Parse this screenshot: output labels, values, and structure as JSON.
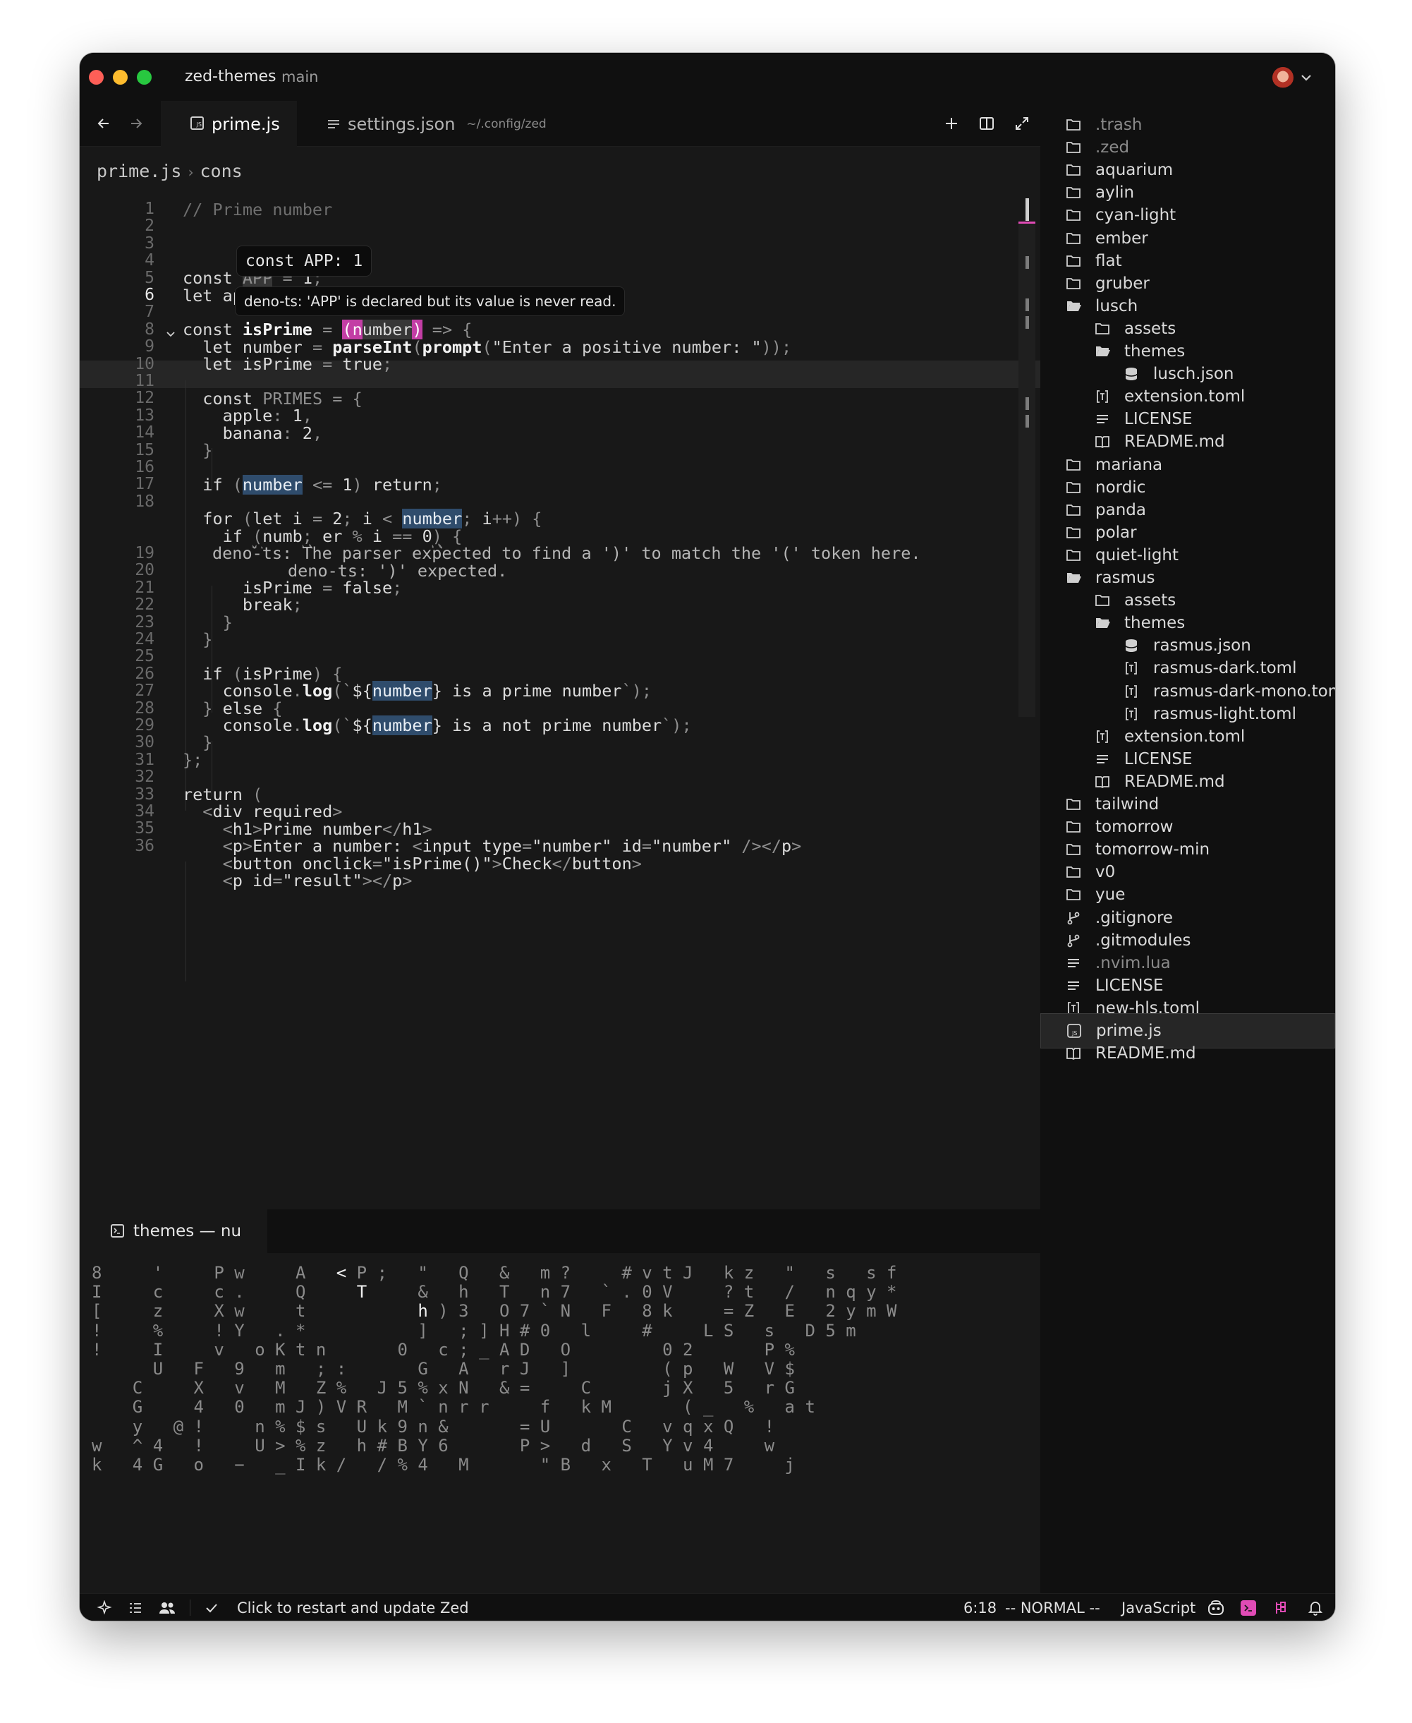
{
  "window": {
    "project": "zed-themes",
    "branch": "main"
  },
  "tabs": [
    {
      "label": "prime.js",
      "active": true
    },
    {
      "label": "settings.json",
      "path": "~/.config/zed",
      "active": false
    }
  ],
  "breadcrumb": {
    "file": "prime.js",
    "symbol": "cons"
  },
  "hover_tooltip": "const APP: 1",
  "diagnostic_tooltip": "deno-ts: 'APP' is declared but its value is never read.",
  "code": {
    "line_numbers": [
      "1",
      "2",
      "3",
      "4",
      "5",
      "6",
      "7",
      "8",
      "9",
      "10",
      "11",
      "12",
      "13",
      "14",
      "15",
      "16",
      "17",
      "18",
      "",
      "",
      "19",
      "20",
      "21",
      "22",
      "23",
      "24",
      "25",
      "26",
      "27",
      "28",
      "29",
      "30",
      "31",
      "32",
      "33",
      "34",
      "35",
      "36"
    ],
    "current_line": "6",
    "line1_comment": "// Prime number",
    "inline_diagnostic_1": "deno-ts: The parser expected to find a ')' to match the '(' token here.",
    "inline_diagnostic_2": "deno-ts: ')' expected."
  },
  "terminal": {
    "tab_label": "themes — nu",
    "rows": [
      {
        "dim": "8     '     P w     A   ",
        "bright": "<",
        "rest": " P ;   \"   Q   &   m ?     # v t J   k z   \"   s   s f"
      },
      {
        "dim": "I     c     c .     Q     ",
        "bright": "T",
        "rest": "     &   h   T   n 7   ` . 0 V     ? t   /   n q y *"
      },
      {
        "dim": "[     z     X w     t           ",
        "bright": "h",
        "rest": " ) 3   O 7 ` N   F   8 k     = Z   E   2 y m W"
      },
      {
        "dim": "!     %     ! Y   . *           ]   ; ] H # 0   l     #     L S   s   D 5 m",
        "bright": "",
        "rest": ""
      },
      {
        "dim": "!     I     v   o K t n       0   c ; _ A D   O         0 2       P %",
        "bright": "",
        "rest": ""
      },
      {
        "dim": "      U   F   9   m   ; :       G   A   r J   ]         ( p   W   V $",
        "bright": "",
        "rest": ""
      },
      {
        "dim": "    C     X   v   M   Z %   J 5 % x N   & =     C       j X   5   r G",
        "bright": "",
        "rest": ""
      },
      {
        "dim": "    G     4   0   m J ) V R   M ` n r r     f   k M       ( _   %   a t",
        "bright": "",
        "rest": ""
      },
      {
        "dim": "    y   @ !     n % $ s   U k 9 n &       = U       C   v q x Q   !",
        "bright": "",
        "rest": ""
      },
      {
        "dim": "w   ^ 4   !     U > % z   h # B Y 6       P >   d   S   Y v 4     w",
        "bright": "",
        "rest": ""
      },
      {
        "dim": "k   4 G   o   −   _ I k /   / % 4   M       \" B   x   T   u M 7     j",
        "bright": "",
        "rest": ""
      }
    ]
  },
  "file_tree": [
    {
      "name": ".trash",
      "icon": "folder-icon",
      "depth": 0,
      "dim": true
    },
    {
      "name": ".zed",
      "icon": "folder-icon",
      "depth": 0,
      "dim": true
    },
    {
      "name": "aquarium",
      "icon": "folder-icon",
      "depth": 0
    },
    {
      "name": "aylin",
      "icon": "folder-icon",
      "depth": 0
    },
    {
      "name": "cyan-light",
      "icon": "folder-icon",
      "depth": 0
    },
    {
      "name": "ember",
      "icon": "folder-icon",
      "depth": 0
    },
    {
      "name": "flat",
      "icon": "folder-icon",
      "depth": 0
    },
    {
      "name": "gruber",
      "icon": "folder-icon",
      "depth": 0
    },
    {
      "name": "lusch",
      "icon": "folder-open-icon",
      "depth": 0
    },
    {
      "name": "assets",
      "icon": "folder-icon",
      "depth": 1
    },
    {
      "name": "themes",
      "icon": "folder-open-icon",
      "depth": 1
    },
    {
      "name": "lusch.json",
      "icon": "database-icon",
      "depth": 2
    },
    {
      "name": "extension.toml",
      "icon": "toml-icon",
      "depth": 1
    },
    {
      "name": "LICENSE",
      "icon": "lines-icon",
      "depth": 1
    },
    {
      "name": "README.md",
      "icon": "book-icon",
      "depth": 1
    },
    {
      "name": "mariana",
      "icon": "folder-icon",
      "depth": 0
    },
    {
      "name": "nordic",
      "icon": "folder-icon",
      "depth": 0
    },
    {
      "name": "panda",
      "icon": "folder-icon",
      "depth": 0
    },
    {
      "name": "polar",
      "icon": "folder-icon",
      "depth": 0
    },
    {
      "name": "quiet-light",
      "icon": "folder-icon",
      "depth": 0
    },
    {
      "name": "rasmus",
      "icon": "folder-open-icon",
      "depth": 0
    },
    {
      "name": "assets",
      "icon": "folder-icon",
      "depth": 1
    },
    {
      "name": "themes",
      "icon": "folder-open-icon",
      "depth": 1
    },
    {
      "name": "rasmus.json",
      "icon": "database-icon",
      "depth": 2
    },
    {
      "name": "rasmus-dark.toml",
      "icon": "toml-icon",
      "depth": 2
    },
    {
      "name": "rasmus-dark-mono.toml",
      "icon": "toml-icon",
      "depth": 2
    },
    {
      "name": "rasmus-light.toml",
      "icon": "toml-icon",
      "depth": 2
    },
    {
      "name": "extension.toml",
      "icon": "toml-icon",
      "depth": 1
    },
    {
      "name": "LICENSE",
      "icon": "lines-icon",
      "depth": 1
    },
    {
      "name": "README.md",
      "icon": "book-icon",
      "depth": 1
    },
    {
      "name": "tailwind",
      "icon": "folder-icon",
      "depth": 0
    },
    {
      "name": "tomorrow",
      "icon": "folder-icon",
      "depth": 0
    },
    {
      "name": "tomorrow-min",
      "icon": "folder-icon",
      "depth": 0
    },
    {
      "name": "v0",
      "icon": "folder-icon",
      "depth": 0
    },
    {
      "name": "yue",
      "icon": "folder-icon",
      "depth": 0
    },
    {
      "name": ".gitignore",
      "icon": "git-icon",
      "depth": 0
    },
    {
      "name": ".gitmodules",
      "icon": "git-icon",
      "depth": 0
    },
    {
      "name": ".nvim.lua",
      "icon": "lines-icon",
      "depth": 0,
      "dim": true
    },
    {
      "name": "LICENSE",
      "icon": "lines-icon",
      "depth": 0
    },
    {
      "name": "new-hls.toml",
      "icon": "toml-icon",
      "depth": 0
    },
    {
      "name": "prime.js",
      "icon": "js-icon",
      "depth": 0,
      "selected": true
    },
    {
      "name": "README.md",
      "icon": "book-icon",
      "depth": 0
    }
  ],
  "status_bar": {
    "message": "Click to restart and update Zed",
    "cursor": "6:18",
    "mode": "-- NORMAL --",
    "language": "JavaScript"
  },
  "colors": {
    "background": "#101010",
    "editor": "#181818",
    "accent_pink": "#e04bb5",
    "selection_blue": "#2f4c6c",
    "traffic_red": "#fe5f57",
    "traffic_yellow": "#febc2e",
    "traffic_green": "#28c840"
  }
}
